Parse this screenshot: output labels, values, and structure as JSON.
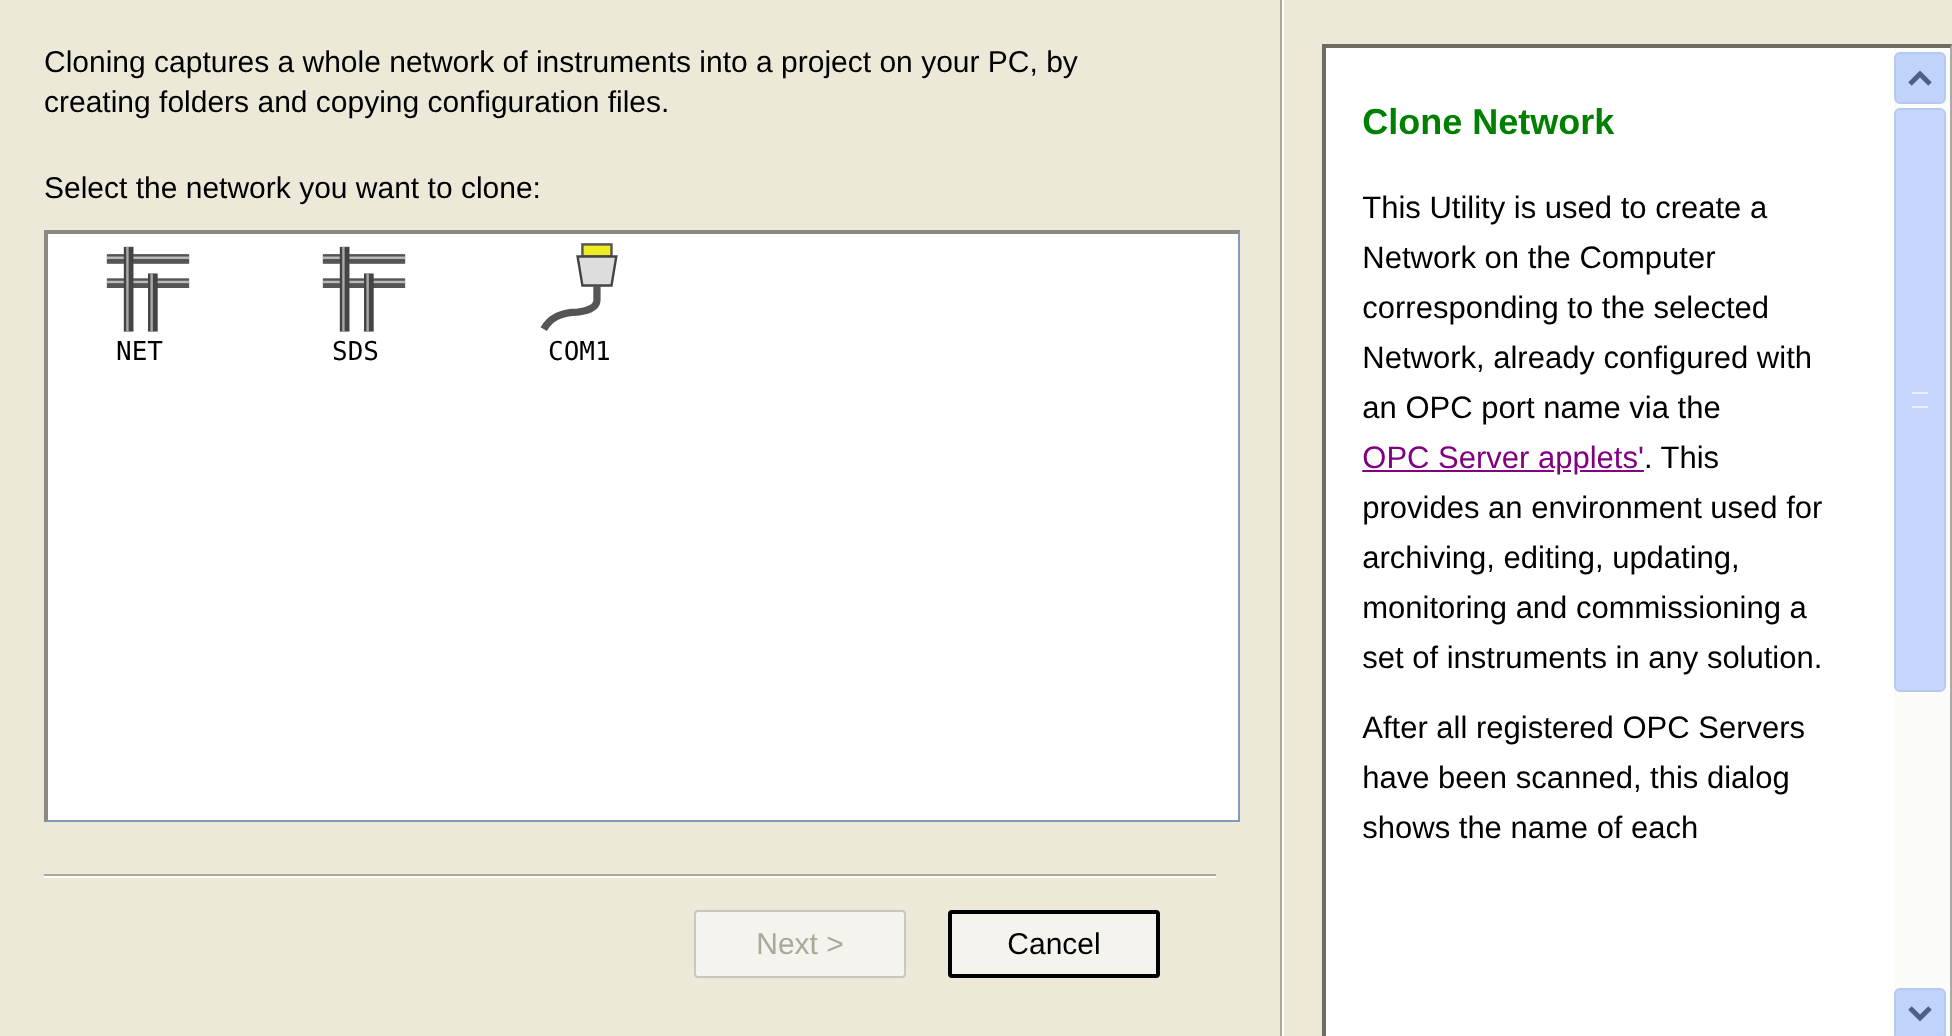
{
  "intro": "Cloning captures a whole network of instruments into a project on your PC, by creating folders and copying configuration files.",
  "prompt": "Select the network you want to clone:",
  "networks": [
    {
      "label": "NET",
      "kind": "network"
    },
    {
      "label": "SDS",
      "kind": "network"
    },
    {
      "label": "COM1",
      "kind": "serial"
    }
  ],
  "buttons": [
    {
      "label": "Next >",
      "disabled": true,
      "default": false
    },
    {
      "label": "Cancel",
      "disabled": false,
      "default": true
    }
  ],
  "help": {
    "title": "Clone Network",
    "paragraphs": [
      {
        "before": "This Utility is used to create a Network on the Computer corresponding to the selected Network, already configured with an OPC port name via the ",
        "link": "OPC Server applets'",
        "after": ".  This provides an environment used for archiving, editing, updating, monitoring and commissioning a set of instruments in any solution."
      },
      {
        "before": "After all registered OPC Servers have been scanned, this dialog shows the name of each"
      }
    ]
  }
}
